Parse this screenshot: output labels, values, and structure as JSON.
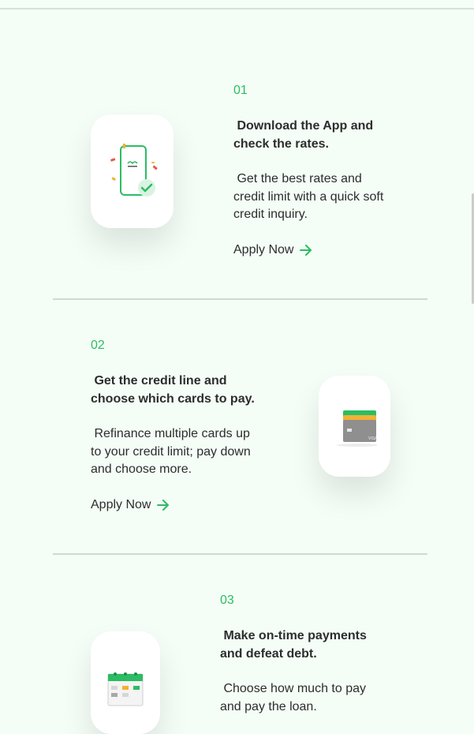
{
  "steps": [
    {
      "number": "01",
      "title": " Download the App and\ncheck the rates.",
      "description": " Get the best rates and\ncredit limit with a quick soft\ncredit inquiry.",
      "cta": "Apply Now",
      "icon": "phone-check-icon"
    },
    {
      "number": "02",
      "title": " Get the credit line and\nchoose which cards to pay.",
      "description": " Refinance multiple cards up\nto your credit limit; pay down\nand choose more.",
      "cta": "Apply Now",
      "icon": "credit-cards-icon",
      "card_brand": "VISA"
    },
    {
      "number": "03",
      "title": " Make on-time payments\nand defeat debt.",
      "description": " Choose how much to pay\nand pay the loan.",
      "icon": "calendar-icon"
    }
  ],
  "colors": {
    "accent": "#2bbd63",
    "background": "#f4fdf6"
  }
}
